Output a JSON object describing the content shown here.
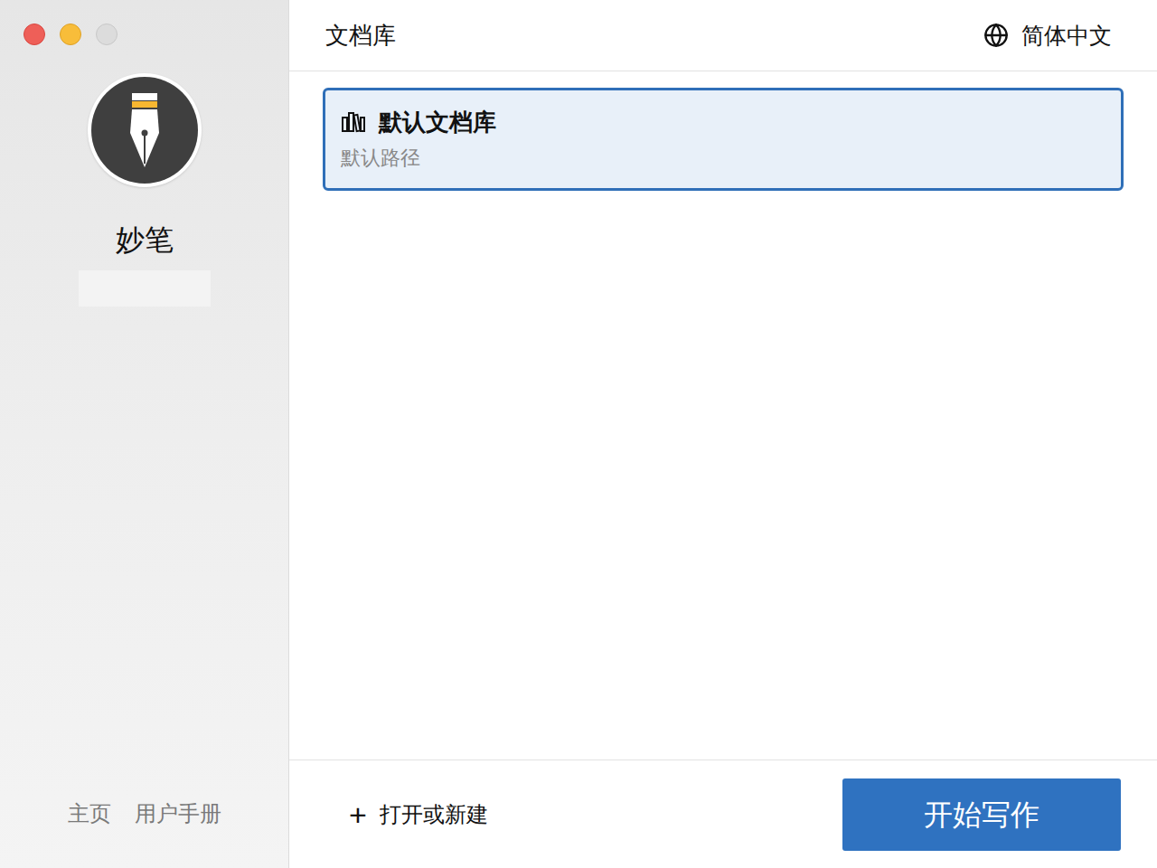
{
  "app": {
    "name": "妙笔"
  },
  "sidebar": {
    "links": [
      "主页",
      "用户手册"
    ]
  },
  "header": {
    "title": "文档库",
    "language": "简体中文"
  },
  "libraries": [
    {
      "name": "默认文档库",
      "path": "默认路径",
      "selected": true
    }
  ],
  "footer": {
    "open_button": {
      "icon": "+",
      "label": "打开或新建"
    },
    "start_button": "开始写作"
  }
}
